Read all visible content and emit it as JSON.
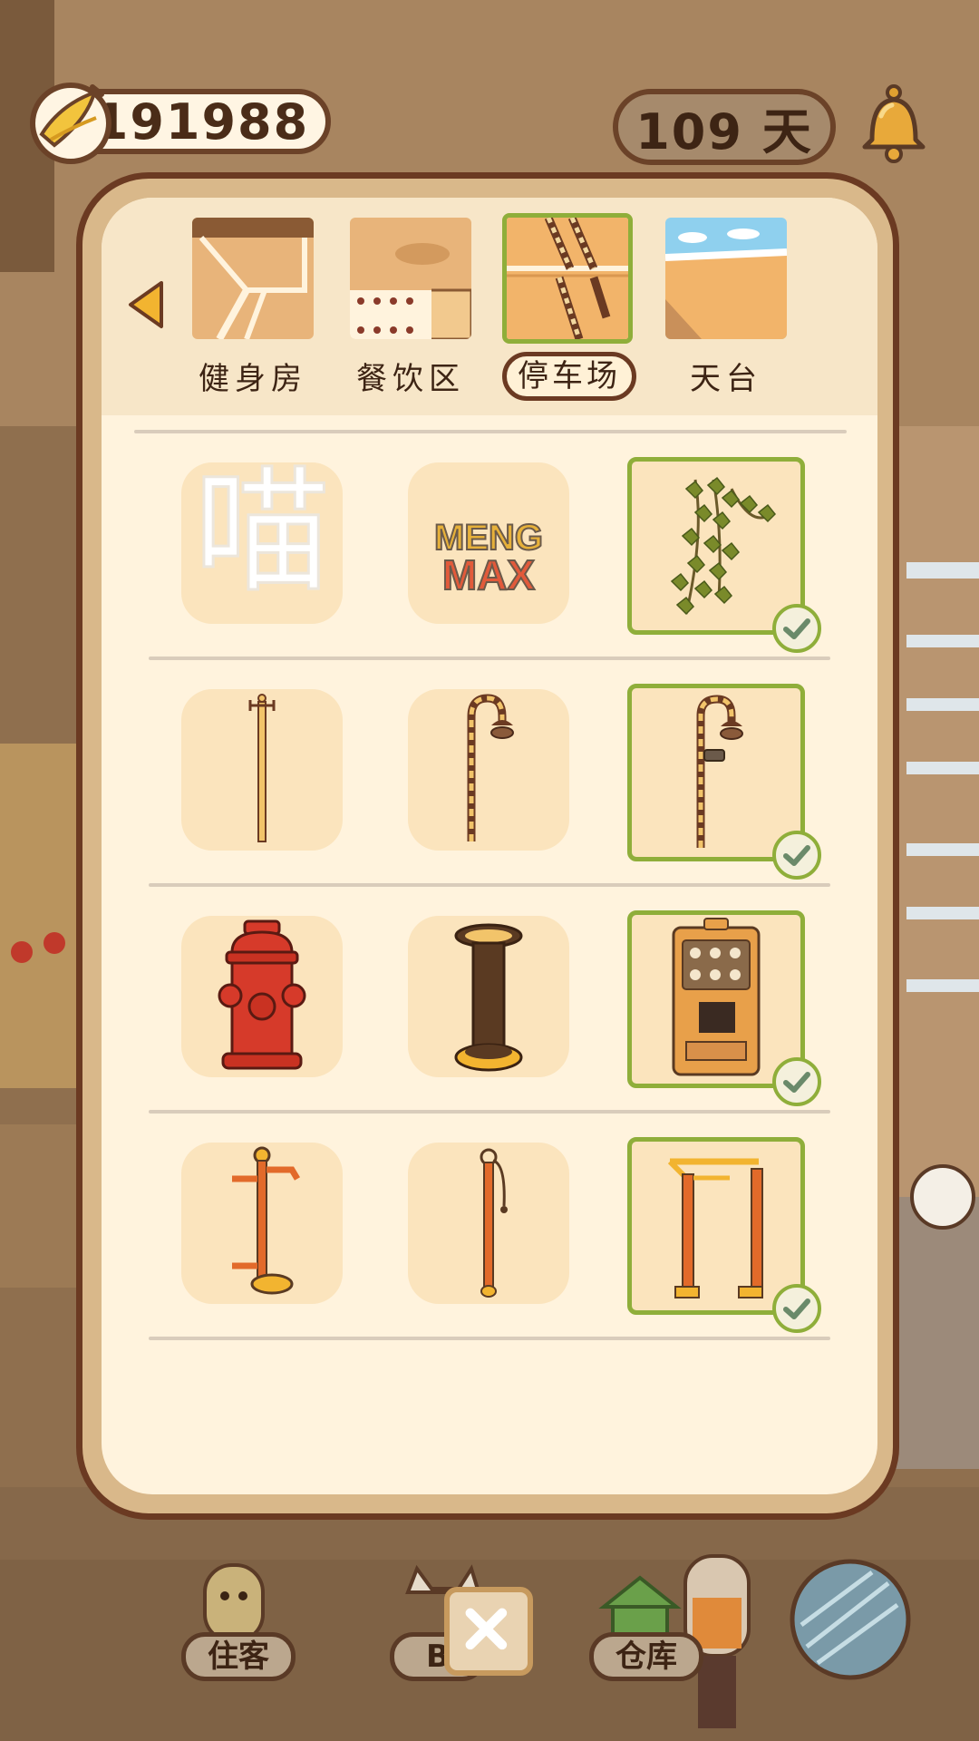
{
  "hud": {
    "coins": "191988",
    "days": "109 天"
  },
  "tabs": [
    {
      "label": "健身房",
      "active": false
    },
    {
      "label": "餐饮区",
      "active": false
    },
    {
      "label": "停车场",
      "active": true
    },
    {
      "label": "天台",
      "active": false
    }
  ],
  "grid": {
    "rows": [
      [
        {
          "name": "meow-sign",
          "text": "喵",
          "owned": false,
          "equipped": false
        },
        {
          "name": "meng-max-graffiti",
          "text": "MENG MAX",
          "owned": false,
          "equipped": false
        },
        {
          "name": "ivy-vine",
          "owned": true,
          "equipped": true
        }
      ],
      [
        {
          "name": "plain-pole",
          "owned": false,
          "equipped": false
        },
        {
          "name": "street-lamp",
          "owned": false,
          "equipped": false
        },
        {
          "name": "street-lamp-camera",
          "owned": true,
          "equipped": true
        }
      ],
      [
        {
          "name": "fire-hydrant",
          "owned": false,
          "equipped": false
        },
        {
          "name": "ashtray-bin",
          "owned": false,
          "equipped": false
        },
        {
          "name": "vending-machine",
          "owned": true,
          "equipped": true
        }
      ],
      [
        {
          "name": "exercise-pole",
          "owned": false,
          "equipped": false
        },
        {
          "name": "hanging-pole",
          "owned": false,
          "equipped": false
        },
        {
          "name": "pull-up-bars",
          "owned": true,
          "equipped": true
        }
      ]
    ]
  },
  "bottom_nav": {
    "guests": "住客",
    "bag": "B",
    "warehouse": "仓库"
  }
}
